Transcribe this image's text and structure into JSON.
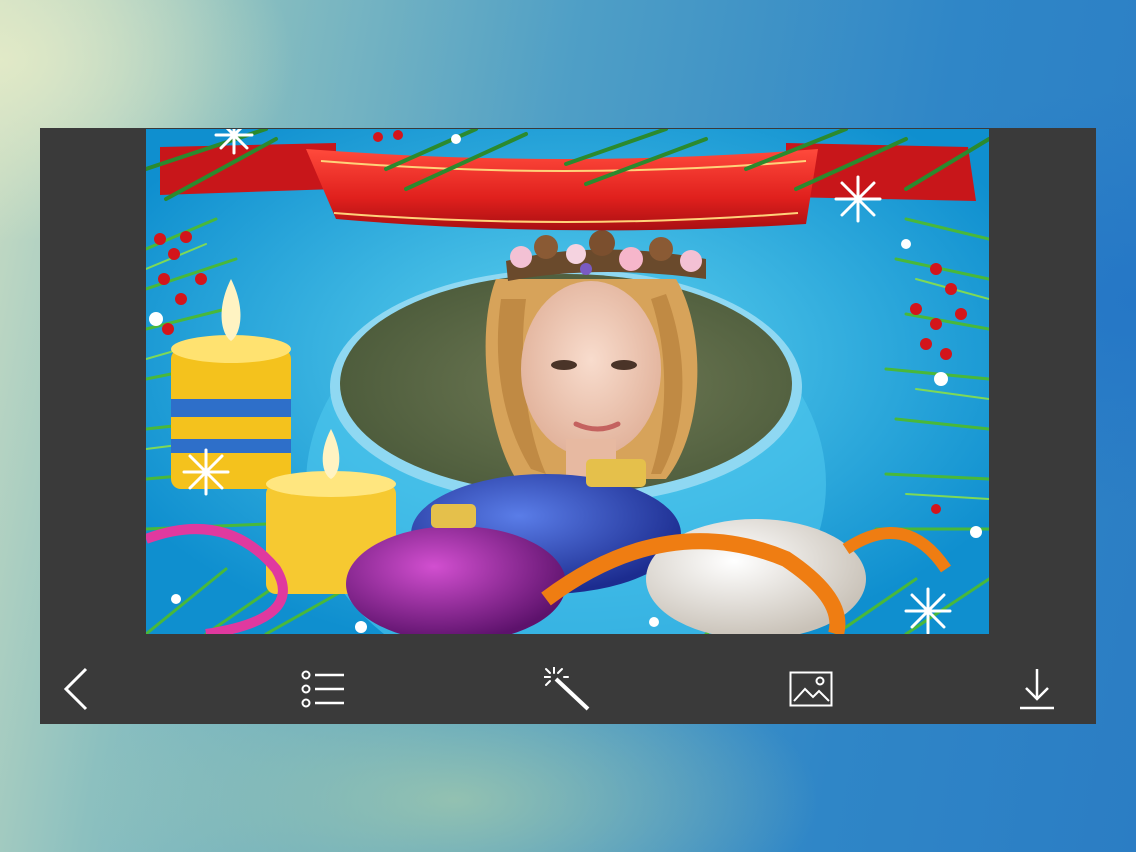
{
  "app": {
    "editor": {
      "frame_theme": "christmas-frame",
      "colors": {
        "panel": "#3a3a3a",
        "ribbon": "#e0201d",
        "sky": "#1aa6d6",
        "icon": "#ffffff"
      }
    },
    "toolbar": {
      "items": [
        {
          "name": "back-button",
          "icon": "chevron-left-icon"
        },
        {
          "name": "frames-list-button",
          "icon": "list-icon"
        },
        {
          "name": "effects-button",
          "icon": "magic-wand-icon"
        },
        {
          "name": "gallery-button",
          "icon": "image-icon"
        },
        {
          "name": "download-button",
          "icon": "download-icon"
        }
      ]
    }
  }
}
